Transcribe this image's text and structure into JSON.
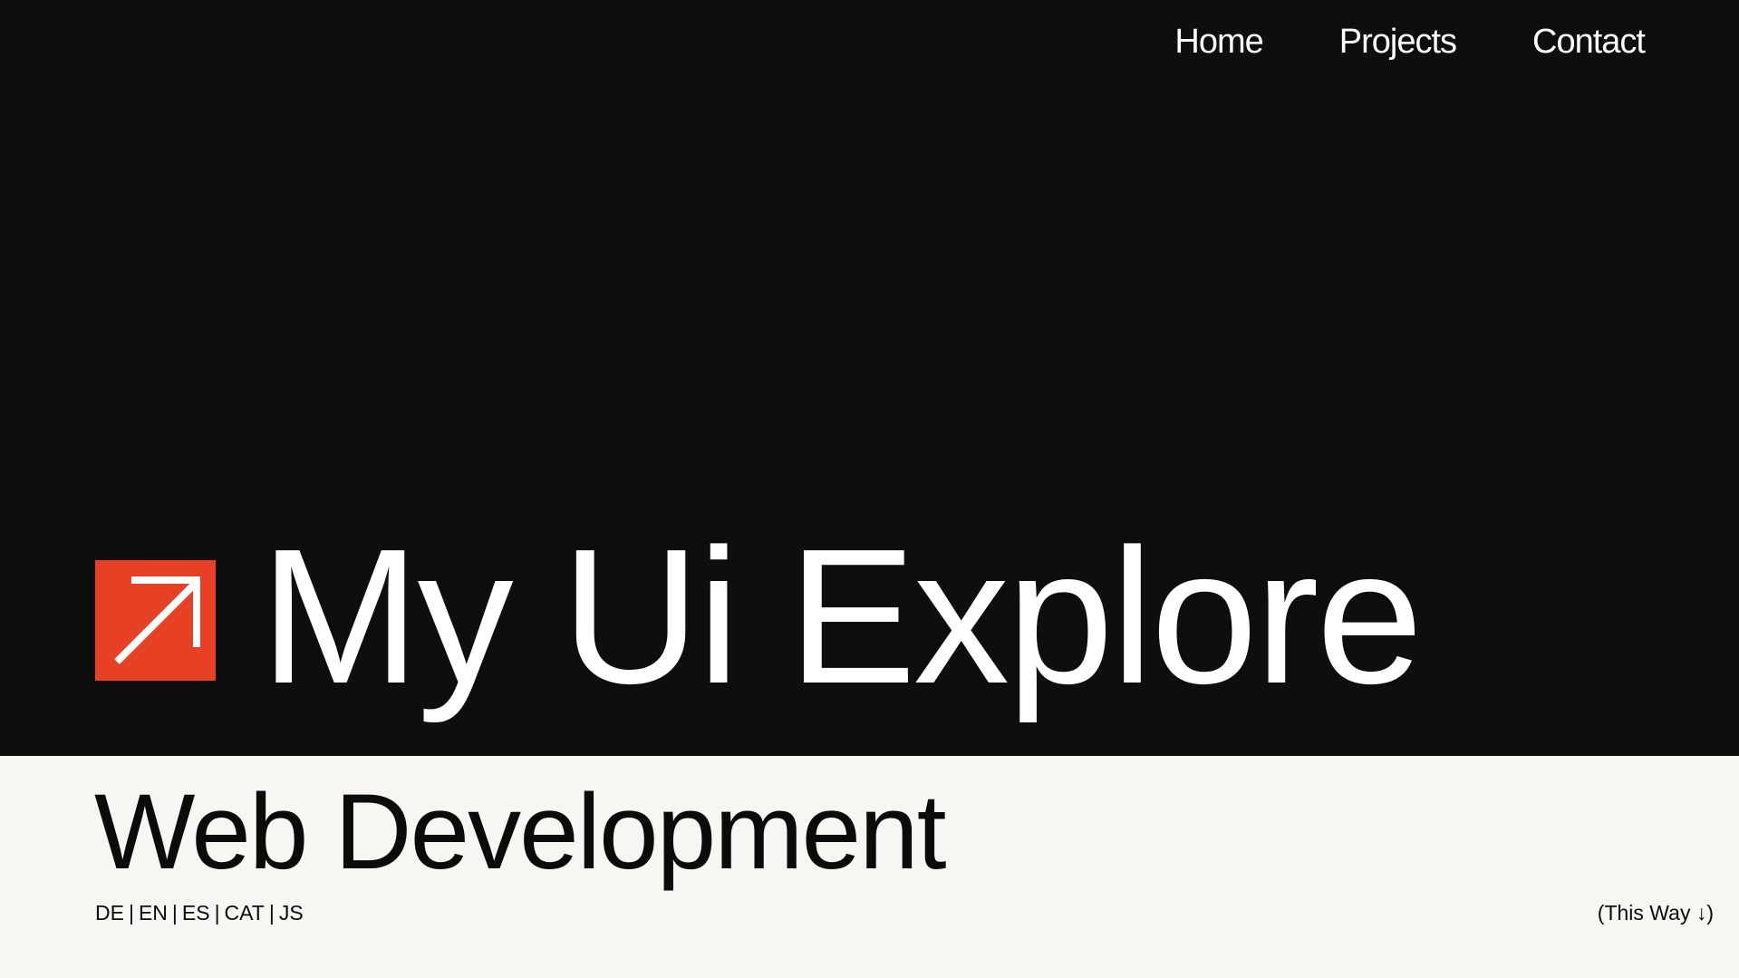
{
  "nav": {
    "items": [
      {
        "label": "Home"
      },
      {
        "label": "Projects"
      },
      {
        "label": "Contact"
      }
    ]
  },
  "hero": {
    "title": "My Ui Explore",
    "logo_icon": "arrow-up-right-icon",
    "logo_color": "#e64125",
    "background_color": "#0e0e0e"
  },
  "lower": {
    "subtitle": "Web Development",
    "background_color": "#f7f6f2",
    "languages": [
      "DE",
      "EN",
      "ES",
      "CAT",
      "JS"
    ],
    "separator": "|",
    "scroll_hint": "(This Way ↓)"
  }
}
